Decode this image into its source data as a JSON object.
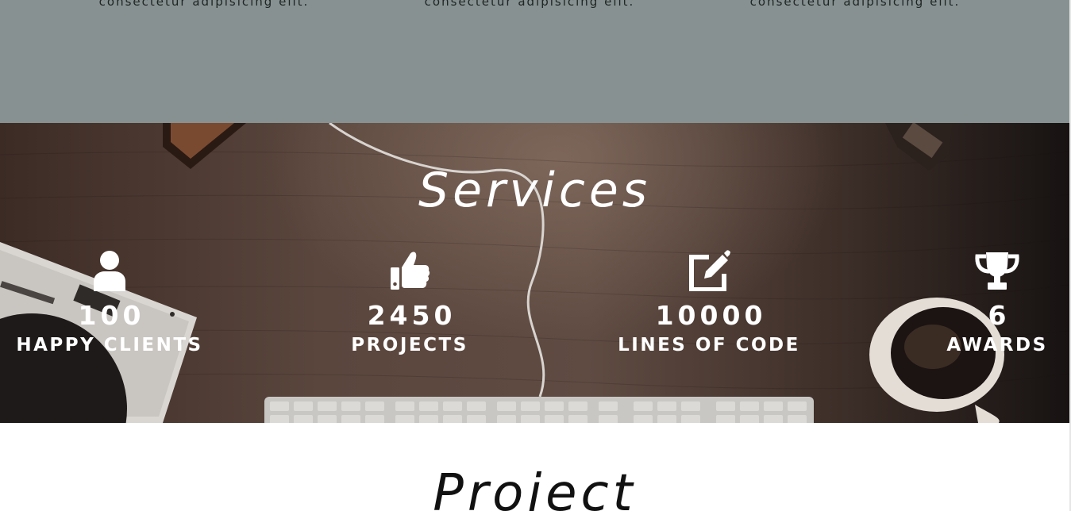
{
  "about": {
    "columns": [
      {
        "text": "consectetur adipisicing elit."
      },
      {
        "text": "consectetur adipisicing elit."
      },
      {
        "text": "consectetur adipisicing elit."
      }
    ]
  },
  "services": {
    "title": "Services",
    "stats": [
      {
        "icon": "user-icon",
        "value": "100",
        "label": "HAPPY CLIENTS"
      },
      {
        "icon": "thumbs-up-icon",
        "value": "2450",
        "label": "PROJECTS"
      },
      {
        "icon": "edit-icon",
        "value": "10000",
        "label": "LINES OF CODE"
      },
      {
        "icon": "trophy-icon",
        "value": "6",
        "label": "AWARDS"
      }
    ]
  },
  "project": {
    "title": "Project"
  },
  "colors": {
    "gray_band": "#879191",
    "text_light": "#ffffff",
    "text_dark": "#111111"
  }
}
